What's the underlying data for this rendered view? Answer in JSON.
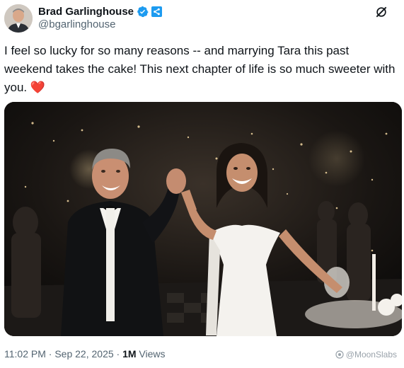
{
  "author": {
    "name": "Brad Garlinghouse",
    "handle": "@bgarlinghouse",
    "verified": true,
    "affiliate_icon": "ripple-logo-icon"
  },
  "header": {
    "grok_icon": "grok-icon"
  },
  "tweet": {
    "text": "I feel so lucky for so many reasons -- and marrying Tara this past weekend takes the cake! This next chapter of life is so much sweeter with you.",
    "emoji": "❤️"
  },
  "media": {
    "type": "photo"
  },
  "meta": {
    "time": "11:02 PM",
    "sep1": " · ",
    "date": "Sep 22, 2025",
    "sep2": " · ",
    "views_count": "1M",
    "views_label": " Views"
  },
  "watermark": {
    "text": "@MoonSlabs"
  },
  "colors": {
    "verified_blue": "#1d9bf0",
    "text": "#0f1419",
    "muted": "#536471",
    "heart": "#e0245e"
  }
}
